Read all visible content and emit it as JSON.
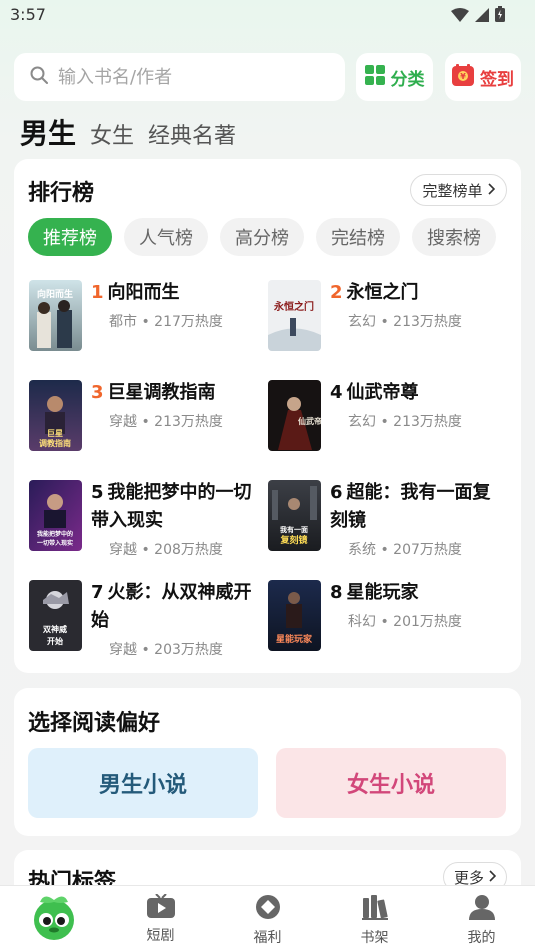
{
  "status": {
    "time": "3:57"
  },
  "search": {
    "placeholder": "输入书名/作者"
  },
  "header_buttons": {
    "category": "分类",
    "signin": "签到"
  },
  "gender_tabs": [
    "男生",
    "女生",
    "经典名著"
  ],
  "ranking": {
    "title": "排行榜",
    "full_list": "完整榜单",
    "tabs": [
      "推荐榜",
      "人气榜",
      "高分榜",
      "完结榜",
      "搜索榜"
    ],
    "books": [
      {
        "rank": "1",
        "title": "向阳而生",
        "genre": "都市",
        "heat": "217万热度"
      },
      {
        "rank": "2",
        "title": "永恒之门",
        "genre": "玄幻",
        "heat": "213万热度"
      },
      {
        "rank": "3",
        "title": "巨星调教指南",
        "genre": "穿越",
        "heat": "213万热度"
      },
      {
        "rank": "4",
        "title": "仙武帝尊",
        "genre": "玄幻",
        "heat": "213万热度"
      },
      {
        "rank": "5",
        "title": "我能把梦中的一切带入现实",
        "genre": "穿越",
        "heat": "208万热度"
      },
      {
        "rank": "6",
        "title": "超能：我有一面复刻镜",
        "genre": "系统",
        "heat": "207万热度"
      },
      {
        "rank": "7",
        "title": "火影：从双神威开始",
        "genre": "穿越",
        "heat": "203万热度"
      },
      {
        "rank": "8",
        "title": "星能玩家",
        "genre": "科幻",
        "heat": "201万热度"
      }
    ]
  },
  "preference": {
    "title": "选择阅读偏好",
    "male": "男生小说",
    "female": "女生小说"
  },
  "hot_tags": {
    "title": "热门标签",
    "more": "更多"
  },
  "bottom_nav": {
    "short_drama": "短剧",
    "welfare": "福利",
    "bookshelf": "书架",
    "mine": "我的"
  },
  "colors": {
    "accent": "#35b24f",
    "hot_rank": "#f0662c",
    "signin": "#e83f3f"
  }
}
